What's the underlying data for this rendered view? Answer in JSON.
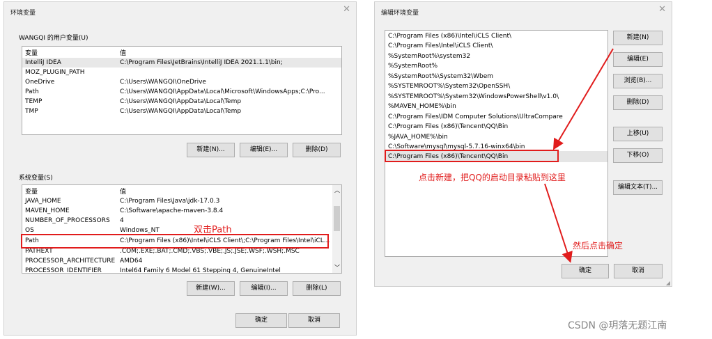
{
  "env_dialog": {
    "title": "环境变量",
    "user_group_label": "WANGQI 的用户变量(U)",
    "columns": [
      "变量",
      "值"
    ],
    "user_vars": [
      {
        "name": "IntelliJ IDEA",
        "value": "C:\\Program Files\\JetBrains\\IntelliJ IDEA 2021.1.1\\bin;"
      },
      {
        "name": "MOZ_PLUGIN_PATH",
        "value": ""
      },
      {
        "name": "OneDrive",
        "value": "C:\\Users\\WANGQI\\OneDrive"
      },
      {
        "name": "Path",
        "value": "C:\\Users\\WANGQI\\AppData\\Local\\Microsoft\\WindowsApps;C:\\Pro..."
      },
      {
        "name": "TEMP",
        "value": "C:\\Users\\WANGQI\\AppData\\Local\\Temp"
      },
      {
        "name": "TMP",
        "value": "C:\\Users\\WANGQI\\AppData\\Local\\Temp"
      }
    ],
    "user_buttons": {
      "new": "新建(N)...",
      "edit": "编辑(E)...",
      "delete": "删除(D)"
    },
    "system_group_label": "系统变量(S)",
    "system_vars": [
      {
        "name": "JAVA_HOME",
        "value": "C:\\Program Files\\Java\\jdk-17.0.3"
      },
      {
        "name": "MAVEN_HOME",
        "value": "C:\\Software\\apache-maven-3.8.4"
      },
      {
        "name": "NUMBER_OF_PROCESSORS",
        "value": "4"
      },
      {
        "name": "OS",
        "value": "Windows_NT"
      },
      {
        "name": "Path",
        "value": "C:\\Program Files (x86)\\Intel\\iCLS Client\\;C:\\Program Files\\Intel\\iCL..."
      },
      {
        "name": "PATHEXT",
        "value": ".COM;.EXE;.BAT;.CMD;.VBS;.VBE;.JS;.JSE;.WSF;.WSH;.MSC"
      },
      {
        "name": "PROCESSOR_ARCHITECTURE",
        "value": "AMD64"
      },
      {
        "name": "PROCESSOR_IDENTIFIER",
        "value": "Intel64 Family 6 Model 61 Stepping 4, GenuineIntel"
      }
    ],
    "system_buttons": {
      "new": "新建(W)...",
      "edit": "编辑(I)...",
      "delete": "删除(L)"
    },
    "ok": "确定",
    "cancel": "取消",
    "annotation_double_click": "双击Path"
  },
  "edit_dialog": {
    "title": "编辑环境变量",
    "paths": [
      "C:\\Program Files (x86)\\Intel\\iCLS Client\\",
      "C:\\Program Files\\Intel\\iCLS Client\\",
      "%SystemRoot%\\system32",
      "%SystemRoot%",
      "%SystemRoot%\\System32\\Wbem",
      "%SYSTEMROOT%\\System32\\OpenSSH\\",
      "%SYSTEMROOT%\\System32\\WindowsPowerShell\\v1.0\\",
      "%MAVEN_HOME%\\bin",
      "C:\\Program Files\\IDM Computer Solutions\\UltraCompare",
      "C:\\Program Files (x86)\\Tencent\\QQ\\Bin",
      "%JAVA_HOME%\\bin",
      "C:\\Software\\mysql\\mysql-5.7.16-winx64\\bin",
      "C:\\Program Files (x86)\\Tencent\\QQ\\Bin"
    ],
    "buttons": {
      "new": "新建(N)",
      "edit": "编辑(E)",
      "browse": "浏览(B)...",
      "delete": "删除(D)",
      "move_up": "上移(U)",
      "move_down": "下移(O)",
      "edit_text": "编辑文本(T)..."
    },
    "ok": "确定",
    "cancel": "取消",
    "annotation_new": "点击新建，把QQ的启动目录粘贴到这里",
    "annotation_ok": "然后点击确定"
  },
  "watermark": "CSDN @玥落无题江南",
  "colors": {
    "annotation": "#e11c1c",
    "dialog_bg": "#f0f0f0",
    "button_bg": "#e1e1e1"
  }
}
